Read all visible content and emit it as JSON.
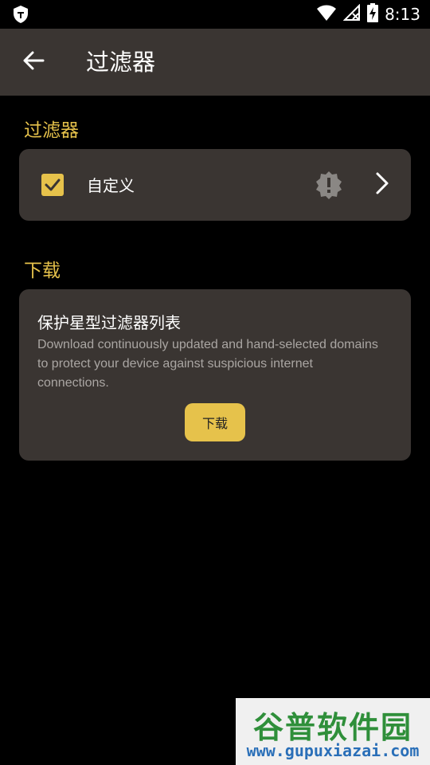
{
  "status_bar": {
    "time": "8:13",
    "icons": [
      "shield-notification-icon",
      "wifi-icon",
      "no-signal-icon",
      "battery-charging-icon"
    ]
  },
  "app_bar": {
    "title": "过滤器",
    "back_icon": "arrow-back-icon"
  },
  "filters_section": {
    "label": "过滤器",
    "custom_item": {
      "label": "自定义",
      "checked": true,
      "warning_icon": "alert-badge-icon",
      "chevron_icon": "chevron-right-icon"
    }
  },
  "download_section": {
    "label": "下载",
    "card": {
      "title": "保护星型过滤器列表",
      "description": "Download continuously updated and hand-selected domains to protect your device against suspicious internet connections.",
      "button_label": "下载"
    }
  },
  "watermark": {
    "brand": "谷普软件园",
    "url": "www.gupuxiazai.com"
  },
  "colors": {
    "accent": "#e6c24b",
    "surface": "#3a3532",
    "background": "#000000",
    "watermark_green": "#2f8f3a",
    "watermark_blue": "#2a6fb8"
  }
}
